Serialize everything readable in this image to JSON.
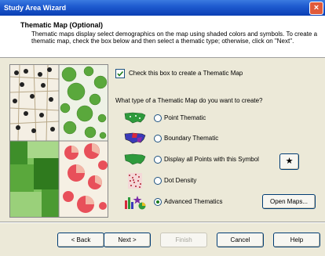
{
  "window": {
    "title": "Study Area Wizard"
  },
  "header": {
    "title": "Thematic Map (Optional)",
    "description": "Thematic maps display select demographics on the map using shaded colors and symbols.  To create a thematic map, check the box below and then select a thematic type; otherwise, click on \"Next\"."
  },
  "create_checkbox": {
    "label": "Check this box to create a Thematic Map",
    "checked": true
  },
  "question": "What type of a Thematic Map do you want to create?",
  "options": [
    {
      "label": "Point Thematic",
      "icon": "us-map-green-dots-icon",
      "selected": false
    },
    {
      "label": "Boundary Thematic",
      "icon": "us-map-colored-states-icon",
      "selected": false
    },
    {
      "label": "Display all Points with this Symbol",
      "icon": "us-map-green-icon",
      "selected": false
    },
    {
      "label": "Dot Density",
      "icon": "dot-density-icon",
      "selected": false
    },
    {
      "label": "Advanced Thematics",
      "icon": "advanced-thematics-icon",
      "selected": true
    }
  ],
  "buttons": {
    "symbol": "★",
    "open_maps": "Open Maps...",
    "back": "< Back",
    "next": "Next >",
    "finish": "Finish",
    "cancel": "Cancel",
    "help": "Help"
  },
  "colors": {
    "titlebar": "#0a3fb4",
    "map_green": "#5aa83c",
    "pie_red": "#e8505a",
    "radio_dot": "#1a7a1a"
  }
}
